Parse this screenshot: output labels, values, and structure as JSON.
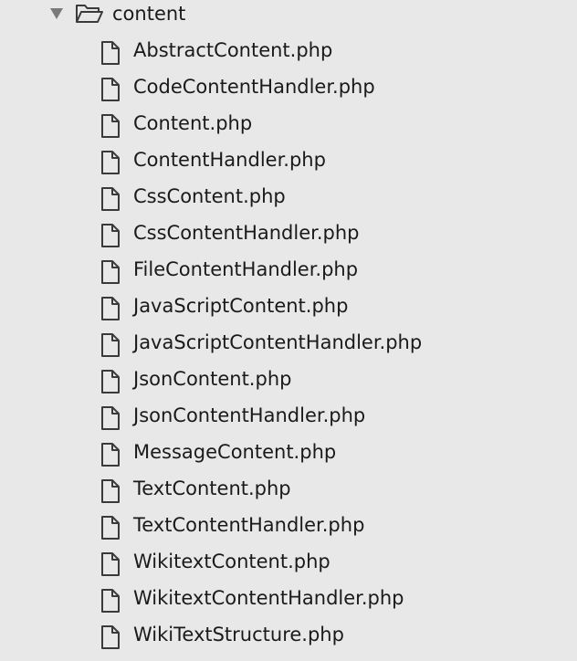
{
  "folder": {
    "name": "content",
    "expanded": true,
    "disclosure_icon": "disclosure-triangle-down-icon",
    "icon": "folder-open-icon"
  },
  "files": [
    {
      "label": "AbstractContent.php",
      "icon": "file-icon"
    },
    {
      "label": "CodeContentHandler.php",
      "icon": "file-icon"
    },
    {
      "label": "Content.php",
      "icon": "file-icon"
    },
    {
      "label": "ContentHandler.php",
      "icon": "file-icon"
    },
    {
      "label": "CssContent.php",
      "icon": "file-icon"
    },
    {
      "label": "CssContentHandler.php",
      "icon": "file-icon"
    },
    {
      "label": "FileContentHandler.php",
      "icon": "file-icon"
    },
    {
      "label": "JavaScriptContent.php",
      "icon": "file-icon"
    },
    {
      "label": "JavaScriptContentHandler.php",
      "icon": "file-icon"
    },
    {
      "label": "JsonContent.php",
      "icon": "file-icon"
    },
    {
      "label": "JsonContentHandler.php",
      "icon": "file-icon"
    },
    {
      "label": "MessageContent.php",
      "icon": "file-icon"
    },
    {
      "label": "TextContent.php",
      "icon": "file-icon"
    },
    {
      "label": "TextContentHandler.php",
      "icon": "file-icon"
    },
    {
      "label": "WikitextContent.php",
      "icon": "file-icon"
    },
    {
      "label": "WikitextContentHandler.php",
      "icon": "file-icon"
    },
    {
      "label": "WikiTextStructure.php",
      "icon": "file-icon"
    }
  ],
  "colors": {
    "background": "#e8e8e8",
    "text": "#1a1a1a",
    "icon_stroke": "#3a3a3a",
    "disclosure": "#7a7a7a"
  }
}
